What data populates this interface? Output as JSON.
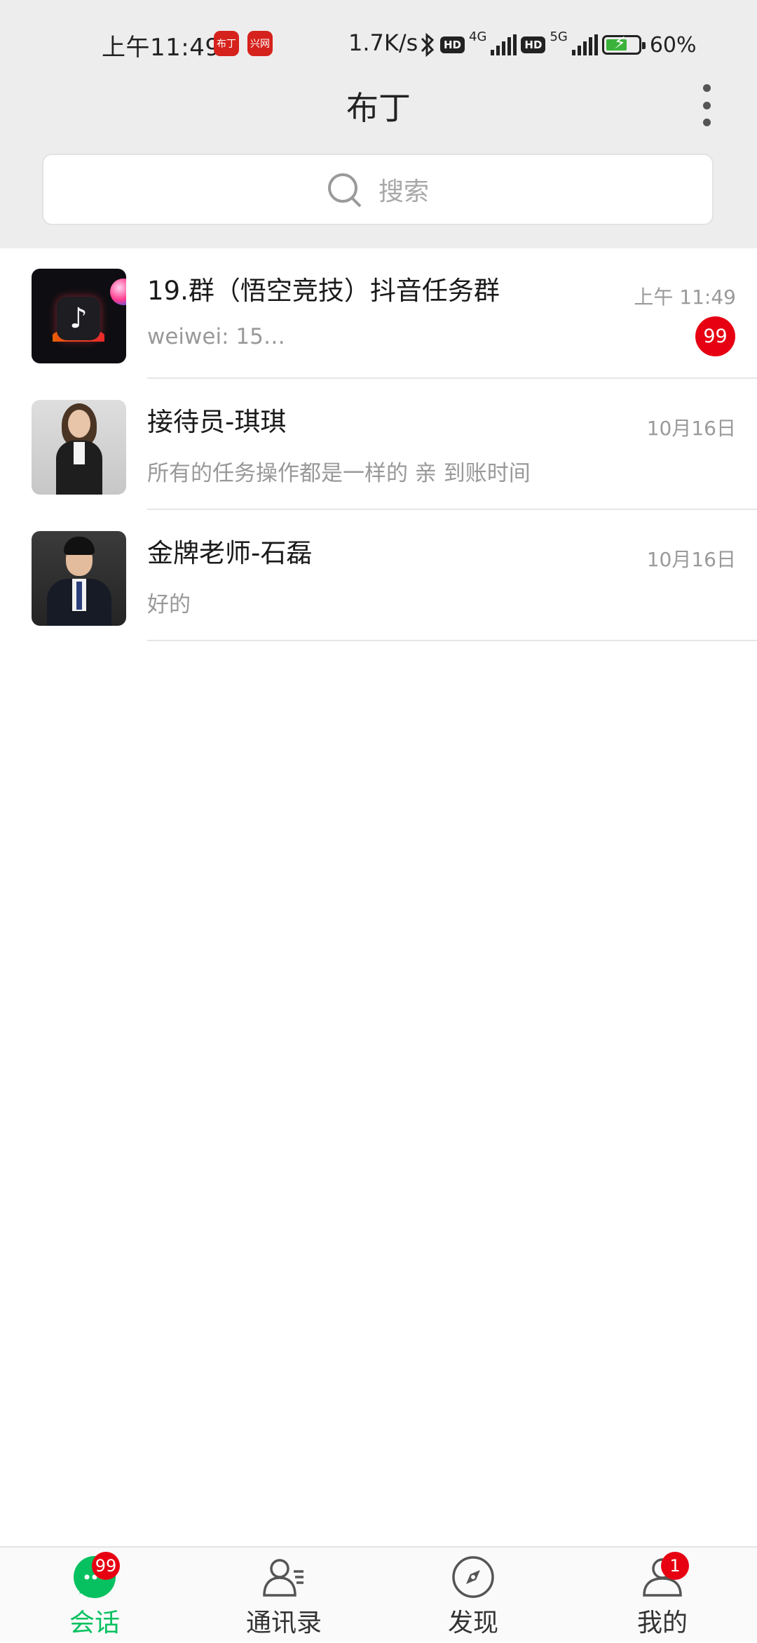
{
  "status_bar": {
    "time": "上午11:49",
    "app_icon_1": "布丁",
    "app_icon_2": "兴网",
    "net_speed": "1.7K/s",
    "hd1": "HD",
    "net1": "4G",
    "hd2": "HD",
    "net2": "5G",
    "battery": "60%"
  },
  "header": {
    "title": "布丁"
  },
  "search": {
    "placeholder": "搜索"
  },
  "chats": [
    {
      "name": "19.群（悟空竞技）抖音任务群",
      "preview": "weiwei:  15…",
      "time": "上午 11:49",
      "unread": "99",
      "avatar": "tiktok-logo"
    },
    {
      "name": "接待员-琪琪",
      "preview": "所有的任务操作都是一样的 亲 到账时间",
      "time": "10月16日",
      "avatar": "woman-photo"
    },
    {
      "name": "金牌老师-石磊",
      "preview": "好的",
      "time": "10月16日",
      "avatar": "man-photo"
    }
  ],
  "bottom_nav": {
    "tabs": [
      {
        "label": "会话",
        "icon": "chat-bubble-icon",
        "badge": "99",
        "active": true
      },
      {
        "label": "通讯录",
        "icon": "contacts-icon"
      },
      {
        "label": "发现",
        "icon": "compass-icon"
      },
      {
        "label": "我的",
        "icon": "person-icon",
        "badge": "1"
      }
    ]
  },
  "colors": {
    "accent": "#07c160",
    "badge": "#e60012",
    "header_bg": "#ededed"
  }
}
